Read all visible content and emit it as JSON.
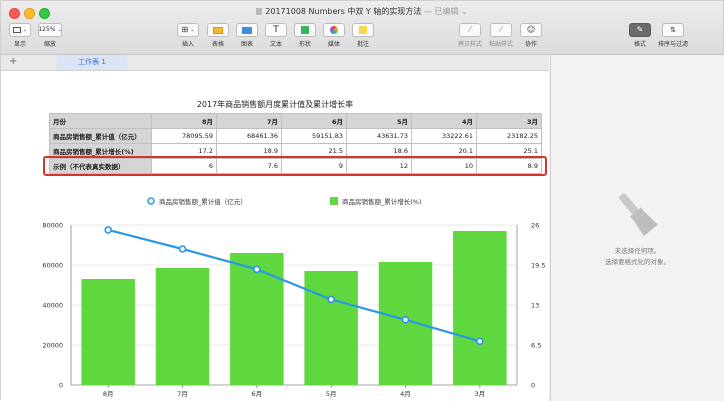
{
  "window": {
    "title": "20171008 Numbers 中双 Y 轴的实现方法",
    "title_suffix": "— 已编辑",
    "chevron": "⌄"
  },
  "toolbar": {
    "view_label": "显示",
    "zoom_value": "125%",
    "zoom_label": "缩放",
    "insert_label": "插入",
    "table_label": "表格",
    "chart_label": "图表",
    "text_label": "文本",
    "shape_label": "形状",
    "media_label": "媒体",
    "comment_label": "批注",
    "copy_style_label": "拷贝样式",
    "paste_style_label": "粘贴样式",
    "collaborate_label": "协作",
    "format_label": "格式",
    "sort_label": "排序与过滤"
  },
  "tabs": {
    "add": "+",
    "sheet1": "工作表 1"
  },
  "sidebar": {
    "line1": "未选择任何项。",
    "line2": "选择要格式化的对象。"
  },
  "table": {
    "title": "2017年商品销售额月度累计值及累计增长率",
    "header": [
      "月份",
      "8月",
      "7月",
      "6月",
      "5月",
      "4月",
      "3月"
    ],
    "rows": [
      [
        "商品房销售额_累计值（亿元）",
        "78095.59",
        "68461.36",
        "59151.83",
        "43631.73",
        "33222.61",
        "23182.25"
      ],
      [
        "商品房销售额_累计增长(%)",
        "17.2",
        "18.9",
        "21.5",
        "18.6",
        "20.1",
        "25.1"
      ],
      [
        "示例（不代表真实数据）",
        "6",
        "7.6",
        "9",
        "12",
        "10",
        "8.9"
      ]
    ]
  },
  "chart_data": {
    "type": "bar",
    "categories": [
      "8月",
      "7月",
      "6月",
      "5月",
      "4月",
      "3月"
    ],
    "series": [
      {
        "name": "商品房销售额_累计值（亿元）",
        "type": "line",
        "axis": "right",
        "values": [
          25.2,
          22.1,
          18.8,
          13.9,
          10.6,
          7.1
        ],
        "color": "#2a98e6"
      },
      {
        "name": "商品房销售额_累计增长(%)",
        "type": "bar",
        "axis": "left",
        "values": [
          53000,
          58500,
          66000,
          57000,
          61500,
          77000
        ],
        "color": "#5fd83f"
      }
    ],
    "yleft": {
      "ticks": [
        "0",
        "20000",
        "40000",
        "60000",
        "80000"
      ],
      "range": [
        0,
        80000
      ]
    },
    "yright": {
      "ticks": [
        "0",
        "6.5",
        "13",
        "19.5",
        "26"
      ],
      "range": [
        0,
        26
      ]
    },
    "grid": true,
    "legend": "top-center"
  }
}
